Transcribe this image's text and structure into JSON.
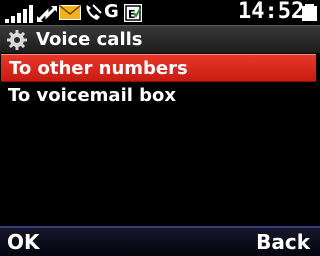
{
  "status_bar": {
    "signal_icon": "signal-strength-icon",
    "data_icon": "data-transfer-icon",
    "message_icon": "envelope-icon",
    "missed_call_icon": "missed-call-icon",
    "network_label": "G",
    "calendar_icon": "calendar-task-icon",
    "time": "14:52",
    "battery_icon": "battery-icon",
    "colors": {
      "envelope": "#f2b21b",
      "battery": "#ffffff"
    }
  },
  "title_bar": {
    "icon": "settings-gear-icon",
    "title": "Voice calls"
  },
  "menu": {
    "items": [
      {
        "label": "To other numbers",
        "selected": true
      },
      {
        "label": "To voicemail box",
        "selected": false
      }
    ],
    "colors": {
      "selected_background": "#d92a1e"
    }
  },
  "softkeys": {
    "left_label": "OK",
    "right_label": "Back"
  }
}
